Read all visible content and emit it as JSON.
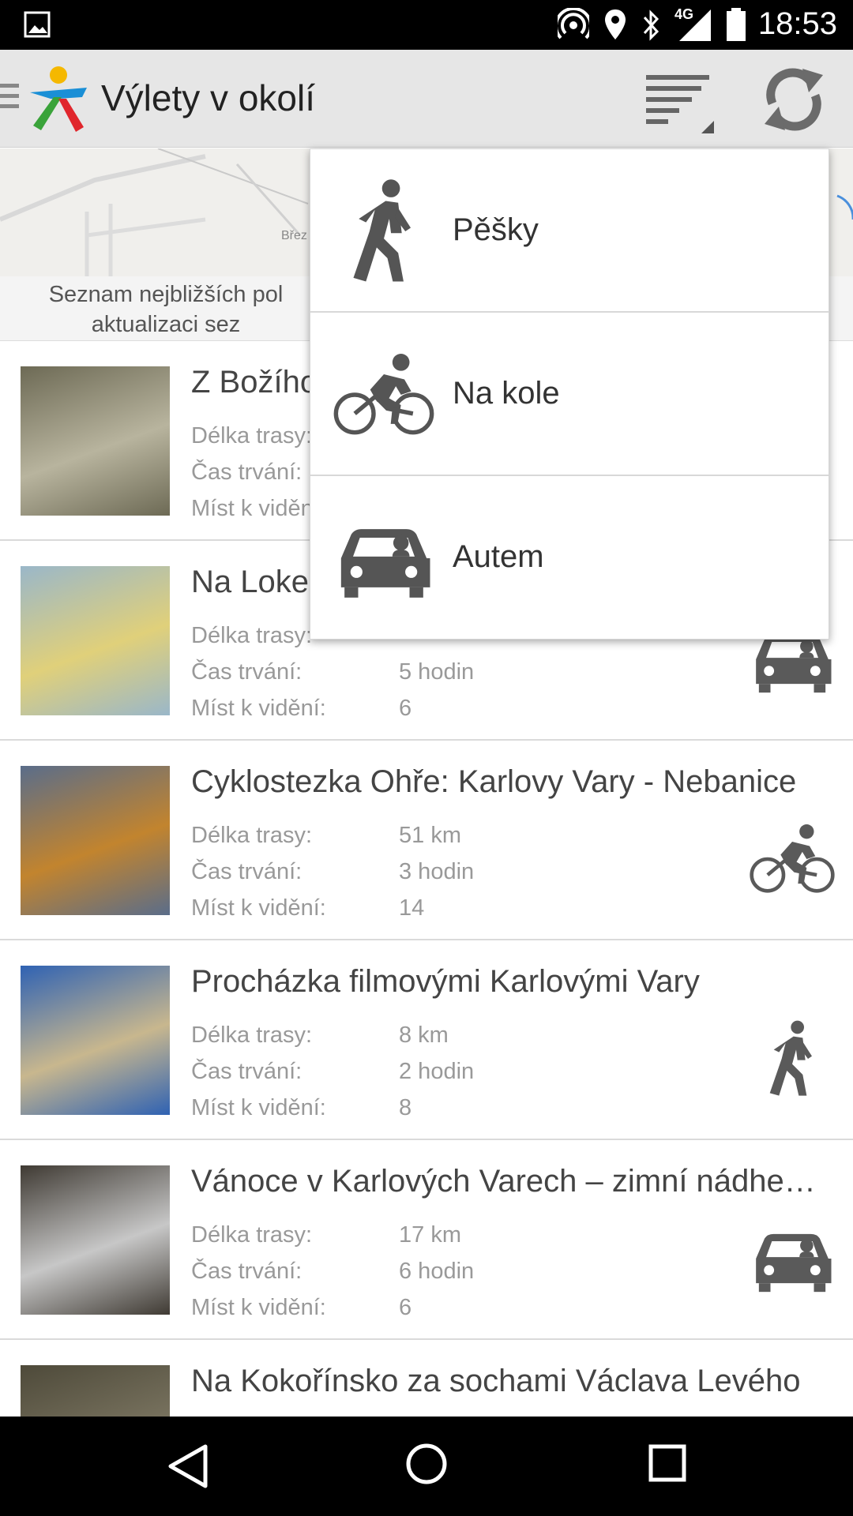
{
  "status_bar": {
    "time": "18:53",
    "network": "4G",
    "icons": [
      "image-icon",
      "hotspot-icon",
      "location-icon",
      "bluetooth-icon",
      "signal-icon",
      "battery-icon"
    ]
  },
  "app_bar": {
    "title": "Výlety v okolí",
    "icons": [
      "menu-icon",
      "app-logo",
      "sort-icon",
      "refresh-icon"
    ]
  },
  "map": {
    "place_label": "Břez",
    "info_text": "Seznam nejbližších pol aktualizaci sez"
  },
  "labels": {
    "length": "Délka trasy:",
    "duration": "Čas trvání:",
    "places": "Míst k vidění:"
  },
  "mode_menu": {
    "items": [
      {
        "label": "Pěšky",
        "icon": "walking-icon"
      },
      {
        "label": "Na kole",
        "icon": "bicycle-icon"
      },
      {
        "label": "Autem",
        "icon": "car-icon"
      }
    ]
  },
  "trips": [
    {
      "title": "Z Božího",
      "length": "",
      "duration": "",
      "places": "",
      "mode": "",
      "thumb_colors": [
        "#6d6a55",
        "#b8b49e"
      ]
    },
    {
      "title": "Na Loke",
      "length": "",
      "duration": "5 hodin",
      "places": "6",
      "mode": "car-icon",
      "thumb_colors": [
        "#9ab7c9",
        "#e0d07a"
      ]
    },
    {
      "title": "Cyklostezka Ohře: Karlovy Vary - Nebanice",
      "length": "51 km",
      "duration": "3 hodin",
      "places": "14",
      "mode": "bicycle-icon",
      "thumb_colors": [
        "#5a6d8a",
        "#c2842e"
      ]
    },
    {
      "title": "Procházka filmovými Karlovými Vary",
      "length": "8 km",
      "duration": "2 hodin",
      "places": "8",
      "mode": "walking-icon",
      "thumb_colors": [
        "#2f62b3",
        "#c8b78e"
      ]
    },
    {
      "title": "Vánoce v Karlových Varech – zimní nádhe…",
      "length": "17 km",
      "duration": "6 hodin",
      "places": "6",
      "mode": "car-icon",
      "thumb_colors": [
        "#3f3a33",
        "#c7c7c7"
      ]
    },
    {
      "title": "Na Kokořínsko za sochami Václava Levého",
      "length": "",
      "duration": "",
      "places": "",
      "mode": "",
      "thumb_colors": [
        "#4e4a3a",
        "#7a7460"
      ]
    }
  ],
  "nav_bar": {
    "icons": [
      "back-icon",
      "home-icon",
      "recents-icon"
    ]
  }
}
